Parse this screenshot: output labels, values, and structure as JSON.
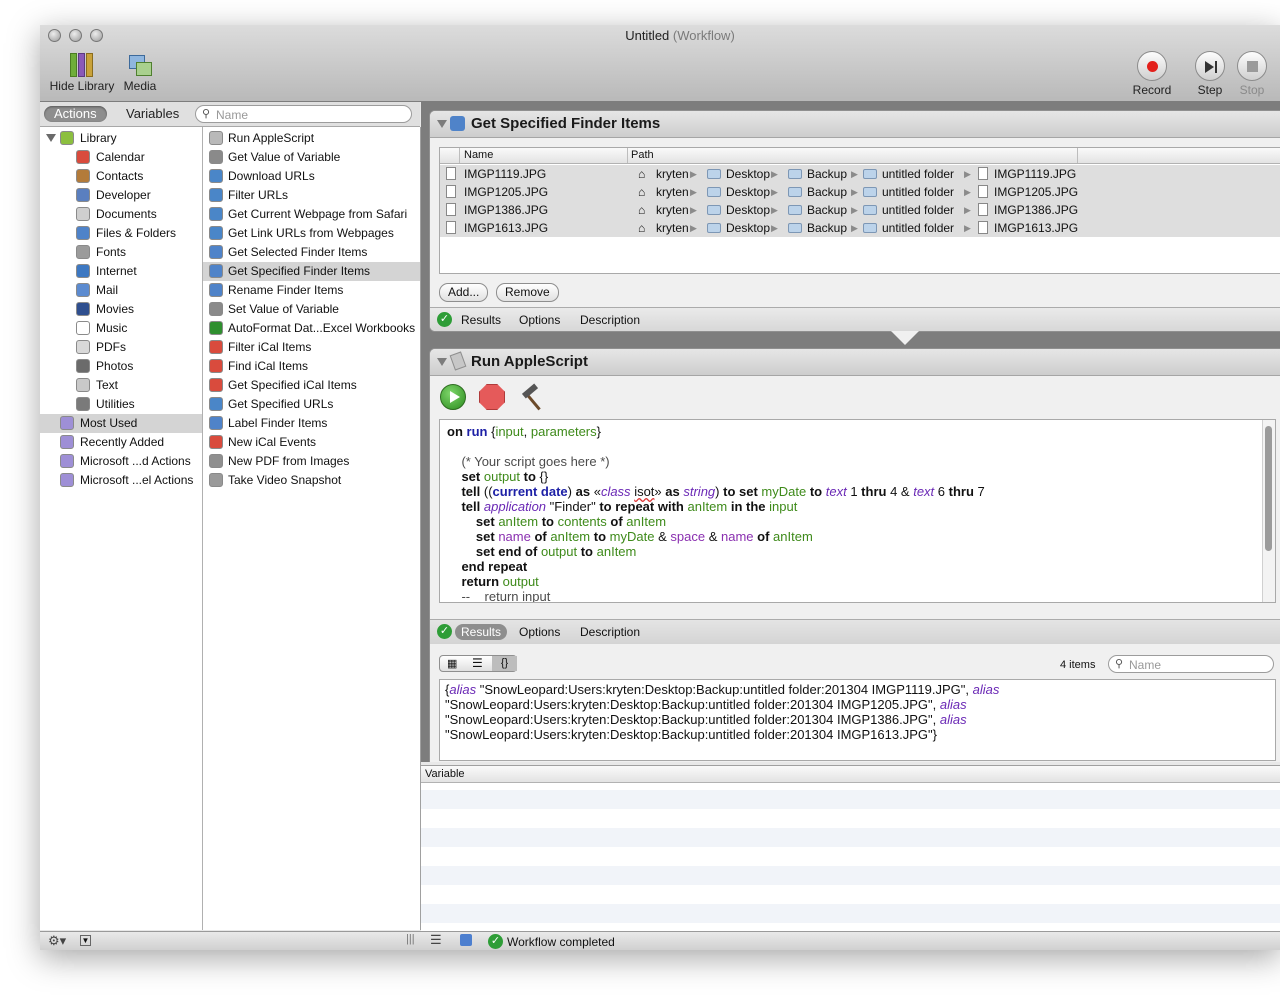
{
  "window": {
    "title": "Untitled",
    "subtitle": "(Workflow)"
  },
  "toolbar": {
    "hide_library": "Hide Library",
    "media": "Media",
    "record": "Record",
    "step": "Step",
    "stop": "Stop"
  },
  "left_tabs": {
    "actions": "Actions",
    "variables": "Variables",
    "search_placeholder": "Name"
  },
  "library": [
    {
      "label": "Library",
      "icon": "library-icon",
      "color": "#8cbf3f"
    },
    {
      "label": "Calendar",
      "icon": "calendar-icon",
      "color": "#d94b3d"
    },
    {
      "label": "Contacts",
      "icon": "contacts-icon",
      "color": "#b37b3a"
    },
    {
      "label": "Developer",
      "icon": "developer-icon",
      "color": "#5a7fbf"
    },
    {
      "label": "Documents",
      "icon": "documents-icon",
      "color": "#cfcfcf"
    },
    {
      "label": "Files & Folders",
      "icon": "finder-icon",
      "color": "#4f83c9"
    },
    {
      "label": "Fonts",
      "icon": "fonts-icon",
      "color": "#9b9b9b"
    },
    {
      "label": "Internet",
      "icon": "internet-icon",
      "color": "#3d78c2"
    },
    {
      "label": "Mail",
      "icon": "mail-icon",
      "color": "#5c8bd0"
    },
    {
      "label": "Movies",
      "icon": "movies-icon",
      "color": "#2f4f8f"
    },
    {
      "label": "Music",
      "icon": "music-icon",
      "color": "#ffffff"
    },
    {
      "label": "PDFs",
      "icon": "pdf-icon",
      "color": "#d9d9d9"
    },
    {
      "label": "Photos",
      "icon": "photos-icon",
      "color": "#6b6b6b"
    },
    {
      "label": "Text",
      "icon": "text-icon",
      "color": "#c9c9c9"
    },
    {
      "label": "Utilities",
      "icon": "utilities-icon",
      "color": "#7a7a7a"
    },
    {
      "label": "Most Used",
      "icon": "smart-folder-icon",
      "color": "#9e8fd6"
    },
    {
      "label": "Recently Added",
      "icon": "smart-folder-icon",
      "color": "#9e8fd6"
    },
    {
      "label": "Microsoft ...d Actions",
      "icon": "smart-folder-icon",
      "color": "#9e8fd6"
    },
    {
      "label": "Microsoft ...el Actions",
      "icon": "smart-folder-icon",
      "color": "#9e8fd6"
    }
  ],
  "actions": [
    {
      "label": "Run AppleScript",
      "icon": "applescript-icon",
      "color": "#b9b9b9"
    },
    {
      "label": "Get Value of Variable",
      "icon": "variable-icon",
      "color": "#8a8a8a"
    },
    {
      "label": "Download URLs",
      "icon": "safari-icon",
      "color": "#4a86c8"
    },
    {
      "label": "Filter URLs",
      "icon": "safari-icon",
      "color": "#4a86c8"
    },
    {
      "label": "Get Current Webpage from Safari",
      "icon": "safari-icon",
      "color": "#4a86c8"
    },
    {
      "label": "Get Link URLs from Webpages",
      "icon": "safari-icon",
      "color": "#4a86c8"
    },
    {
      "label": "Get Selected Finder Items",
      "icon": "finder-icon",
      "color": "#4f83c9"
    },
    {
      "label": "Get Specified Finder Items",
      "icon": "finder-icon",
      "color": "#4f83c9"
    },
    {
      "label": "Rename Finder Items",
      "icon": "finder-icon",
      "color": "#4f83c9"
    },
    {
      "label": "Set Value of Variable",
      "icon": "variable-icon",
      "color": "#8a8a8a"
    },
    {
      "label": "AutoFormat Dat...Excel Workbooks",
      "icon": "excel-icon",
      "color": "#2f8f2f"
    },
    {
      "label": "Filter iCal Items",
      "icon": "calendar-icon",
      "color": "#d94b3d"
    },
    {
      "label": "Find iCal Items",
      "icon": "calendar-icon",
      "color": "#d94b3d"
    },
    {
      "label": "Get Specified iCal Items",
      "icon": "calendar-icon",
      "color": "#d94b3d"
    },
    {
      "label": "Get Specified URLs",
      "icon": "safari-icon",
      "color": "#4a86c8"
    },
    {
      "label": "Label Finder Items",
      "icon": "finder-icon",
      "color": "#4f83c9"
    },
    {
      "label": "New iCal Events",
      "icon": "calendar-icon",
      "color": "#d94b3d"
    },
    {
      "label": "New PDF from Images",
      "icon": "pdf-icon",
      "color": "#8f8f8f"
    },
    {
      "label": "Take Video Snapshot",
      "icon": "camera-icon",
      "color": "#9a9a9a"
    }
  ],
  "finder_action": {
    "title": "Get Specified Finder Items",
    "col_name": "Name",
    "col_path": "Path",
    "items": [
      {
        "name": "IMGP1119.JPG",
        "p1": "kryten",
        "p2": "Desktop",
        "p3": "Backup",
        "p4": "untitled folder",
        "p5": "IMGP1119.JPG"
      },
      {
        "name": "IMGP1205.JPG",
        "p1": "kryten",
        "p2": "Desktop",
        "p3": "Backup",
        "p4": "untitled folder",
        "p5": "IMGP1205.JPG"
      },
      {
        "name": "IMGP1386.JPG",
        "p1": "kryten",
        "p2": "Desktop",
        "p3": "Backup",
        "p4": "untitled folder",
        "p5": "IMGP1386.JPG"
      },
      {
        "name": "IMGP1613.JPG",
        "p1": "kryten",
        "p2": "Desktop",
        "p3": "Backup",
        "p4": "untitled folder",
        "p5": "IMGP1613.JPG"
      }
    ],
    "add": "Add...",
    "remove": "Remove",
    "tabs": [
      "Results",
      "Options",
      "Description"
    ]
  },
  "script_action": {
    "title": "Run AppleScript",
    "tabs": [
      "Results",
      "Options",
      "Description"
    ],
    "count": "4 items",
    "search_placeholder": "Name",
    "results": [
      "{alias \"SnowLeopard:Users:kryten:Desktop:Backup:untitled folder:201304 IMGP1119.JPG\", alias",
      "\"SnowLeopard:Users:kryten:Desktop:Backup:untitled folder:201304 IMGP1205.JPG\", alias",
      "\"SnowLeopard:Users:kryten:Desktop:Backup:untitled folder:201304 IMGP1386.JPG\", alias",
      "\"SnowLeopard:Users:kryten:Desktop:Backup:untitled folder:201304 IMGP1613.JPG\"}"
    ]
  },
  "variables_header": "Variable",
  "status": "Workflow completed"
}
